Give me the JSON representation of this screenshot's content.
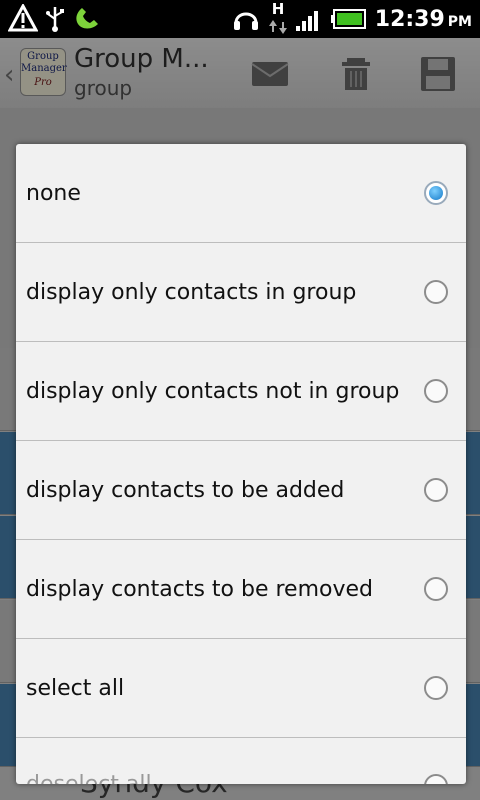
{
  "status_bar": {
    "time": "12:39",
    "ampm": "PM",
    "network_letter": "H",
    "icons": [
      "warning-icon",
      "usb-icon",
      "phone-icon",
      "headset-icon",
      "data-arrows-icon",
      "signal-icon",
      "battery-icon"
    ],
    "colors": {
      "phone": "#7dd33a",
      "battery": "#40c020"
    }
  },
  "app": {
    "title": "Group M...",
    "subtitle": "group",
    "logo_lines": [
      "Group",
      "Manager",
      "Pro"
    ],
    "toolbar_icons": [
      "email-icon",
      "delete-icon",
      "save-icon"
    ],
    "bottom_contact_name": "Syndy Cox"
  },
  "dialog": {
    "options": [
      {
        "label": "none",
        "checked": true
      },
      {
        "label": "display only contacts in group",
        "checked": false
      },
      {
        "label": "display only contacts not in group",
        "checked": false
      },
      {
        "label": "display contacts to be added",
        "checked": false
      },
      {
        "label": "display contacts to be removed",
        "checked": false
      },
      {
        "label": "select all",
        "checked": false
      },
      {
        "label": "deselect all",
        "checked": false
      }
    ]
  },
  "colors": {
    "accent": "#1479c8",
    "row_highlight": "#4a89b8"
  }
}
